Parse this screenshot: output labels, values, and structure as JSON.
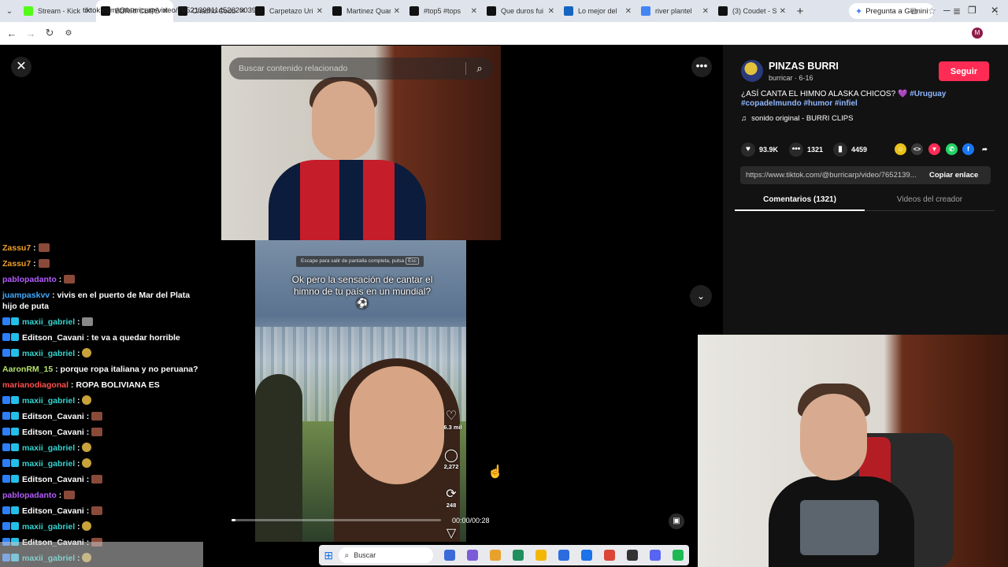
{
  "browser": {
    "tabs": [
      {
        "title": "Stream - Kick",
        "color": "#53fc18",
        "active": false
      },
      {
        "title": "BURRI CLIPS",
        "color": "#111111",
        "active": true
      },
      {
        "title": "Chacho Coude",
        "color": "#111111",
        "active": false
      },
      {
        "title": "Carpetazo Uri",
        "color": "#111111",
        "active": false
      },
      {
        "title": "Martinez Quar",
        "color": "#111111",
        "active": false
      },
      {
        "title": "#top5 #tops",
        "color": "#111111",
        "active": false
      },
      {
        "title": "Que duros fui",
        "color": "#111111",
        "active": false
      },
      {
        "title": "Lo mejor del",
        "color": "#1565c0",
        "active": false
      },
      {
        "title": "river plantel",
        "color": "#4285f4",
        "active": false
      },
      {
        "title": "(3) Coudet - S",
        "color": "#111111",
        "active": false
      }
    ],
    "gemini_label": "Pregunta a Gemini",
    "url": "tiktok.com/@burricarp/video/7652139811452620039",
    "profile_initial": "M"
  },
  "video": {
    "search_placeholder": "Buscar contenido relacionado",
    "fullscreen_hint": "Escape para salir de pantalla completa, pulsa",
    "fullscreen_key": "Esc",
    "caption": "Ok pero la sensación de cantar el himno de tu país en un mundial? ⚽",
    "likes": "16.3 mil",
    "comments": "2,272",
    "reposts": "248",
    "time": "00:00/00:28",
    "progress": 0.02
  },
  "creator": {
    "name": "PINZAS BURRI",
    "meta": "burricar · 6-16",
    "follow_label": "Seguir",
    "desc_text": "¿ASÍ CANTA EL HIMNO ALASKA CHICOS?",
    "tags": [
      "#Uruguay",
      "#copadelmundo",
      "#humor",
      "#infiel"
    ],
    "music": "sonido original - BURRI CLIPS",
    "likes": "93.9K",
    "comments": "1321",
    "saves": "4459",
    "link": "https://www.tiktok.com/@burricarp/video/7652139...",
    "copy_label": "Copiar enlace",
    "tab_comments": "Comentarios (1321)",
    "tab_creator": "Videos del creador"
  },
  "chat": [
    {
      "user": "Zassu7",
      "color": "#f0a02a",
      "badges": [],
      "msg": "",
      "emote": "brown"
    },
    {
      "user": "Zassu7",
      "color": "#f0a02a",
      "badges": [],
      "msg": "",
      "emote": "brown"
    },
    {
      "user": "pablopadanto",
      "color": "#b45cff",
      "badges": [],
      "msg": "",
      "emote": "brown"
    },
    {
      "user": "juampaskvv",
      "color": "#3fa9ff",
      "badges": [],
      "msg": "vivis en el puerto de Mar del Plata hijo de puta",
      "emote": ""
    },
    {
      "user": "maxii_gabriel",
      "color": "#35d4d0",
      "badges": [
        "#2d7ff9",
        "#22c0e8"
      ],
      "msg": "",
      "emote": "grey"
    },
    {
      "user": "Editson_Cavani",
      "color": "#ffffff",
      "badges": [
        "#2d7ff9",
        "#22c0e8"
      ],
      "msg": "te va a quedar horrible",
      "emote": ""
    },
    {
      "user": "maxii_gabriel",
      "color": "#35d4d0",
      "badges": [
        "#2d7ff9",
        "#22c0e8"
      ],
      "msg": "",
      "emote": "round"
    },
    {
      "user": "AaronRM_15",
      "color": "#b6e36a",
      "badges": [],
      "msg": "porque ropa italiana y no peruana?",
      "emote": ""
    },
    {
      "user": "marianodiagonal",
      "color": "#ff4f4f",
      "badges": [],
      "msg": "ROPA BOLIVIANA ES",
      "emote": ""
    },
    {
      "user": "maxii_gabriel",
      "color": "#35d4d0",
      "badges": [
        "#2d7ff9",
        "#22c0e8"
      ],
      "msg": "",
      "emote": "round"
    },
    {
      "user": "Editson_Cavani",
      "color": "#ffffff",
      "badges": [
        "#2d7ff9",
        "#22c0e8"
      ],
      "msg": "",
      "emote": "brown"
    },
    {
      "user": "Editson_Cavani",
      "color": "#ffffff",
      "badges": [
        "#2d7ff9",
        "#22c0e8"
      ],
      "msg": "",
      "emote": "brown"
    },
    {
      "user": "maxii_gabriel",
      "color": "#35d4d0",
      "badges": [
        "#2d7ff9",
        "#22c0e8"
      ],
      "msg": "",
      "emote": "round"
    },
    {
      "user": "maxii_gabriel",
      "color": "#35d4d0",
      "badges": [
        "#2d7ff9",
        "#22c0e8"
      ],
      "msg": "",
      "emote": "round"
    },
    {
      "user": "Editson_Cavani",
      "color": "#ffffff",
      "badges": [
        "#2d7ff9",
        "#22c0e8"
      ],
      "msg": "",
      "emote": "brown"
    },
    {
      "user": "pablopadanto",
      "color": "#b45cff",
      "badges": [],
      "msg": "",
      "emote": "brown"
    },
    {
      "user": "Editson_Cavani",
      "color": "#ffffff",
      "badges": [
        "#2d7ff9",
        "#22c0e8"
      ],
      "msg": "",
      "emote": "brown"
    },
    {
      "user": "maxii_gabriel",
      "color": "#35d4d0",
      "badges": [
        "#2d7ff9",
        "#22c0e8"
      ],
      "msg": "",
      "emote": "round"
    },
    {
      "user": "Editson_Cavani",
      "color": "#ffffff",
      "badges": [
        "#2d7ff9",
        "#22c0e8"
      ],
      "msg": "",
      "emote": "brown"
    },
    {
      "user": "maxii_gabriel",
      "color": "#35d4d0",
      "badges": [
        "#2d7ff9",
        "#22c0e8"
      ],
      "msg": "",
      "emote": "round"
    }
  ],
  "taskbar": {
    "search_label": "Buscar",
    "apps": [
      "#3a6ad8",
      "#7b5cd6",
      "#e8a12a",
      "#1f8f5e",
      "#f2b705",
      "#2d6cdf",
      "#1a73e8",
      "#db4437",
      "#333333",
      "#5865f2",
      "#1db954"
    ]
  }
}
